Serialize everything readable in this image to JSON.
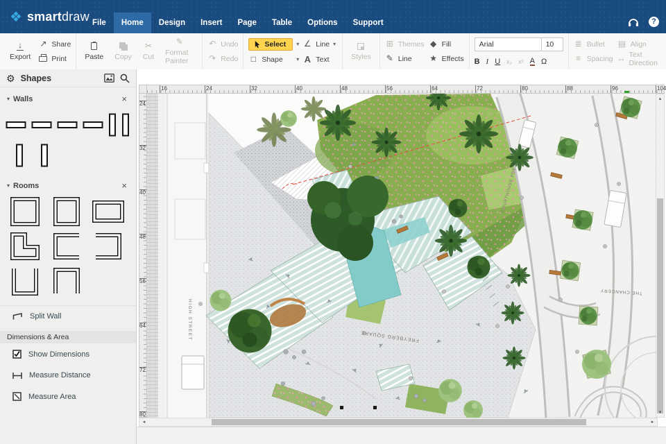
{
  "topbar": {
    "logo": {
      "bold": "smart",
      "light": "draw"
    },
    "menus": [
      {
        "label": "File"
      },
      {
        "label": "Home"
      },
      {
        "label": "Design"
      },
      {
        "label": "Insert"
      },
      {
        "label": "Page"
      },
      {
        "label": "Table"
      },
      {
        "label": "Options"
      },
      {
        "label": "Support"
      }
    ],
    "active_menu": "Home"
  },
  "toolbar": {
    "export": "Export",
    "share": "Share",
    "print": "Print",
    "paste": "Paste",
    "copy": "Copy",
    "cut": "Cut",
    "format_painter": "Format Painter",
    "undo": "Undo",
    "redo": "Redo",
    "select": "Select",
    "shape": "Shape",
    "line_tool": "Line",
    "text_tool": "Text",
    "styles": "Styles",
    "themes": "Themes",
    "line_style": "Line",
    "fill": "Fill",
    "effects": "Effects",
    "font_name": "Arial",
    "font_size": "10",
    "bold": "B",
    "italic": "I",
    "underline": "U",
    "subscript": "x₂",
    "superscript": "x²",
    "font_color": "A",
    "symbol": "Ω",
    "bullet": "Bullet",
    "spacing": "Spacing",
    "align": "Align",
    "text_direction": "Text Direction"
  },
  "icons": {
    "arrow_down": "↓",
    "share": "↗",
    "cut": "✂",
    "format_painter": "✎",
    "undo": "↶",
    "redo": "↷",
    "caret": "▾",
    "line_tool": "∠",
    "shape": "□",
    "text": "A",
    "themes": "⊞",
    "pencil": "✎",
    "fill": "◆",
    "effects": "★",
    "bullet": "≣",
    "spacing": "≡",
    "align": "▤",
    "text_direction": "↔",
    "gear": "⚙",
    "close": "×",
    "section_caret": "▾",
    "scroll_up": "▴",
    "scroll_down": "▾",
    "scroll_left": "◂",
    "scroll_right": "▸",
    "help": "?"
  },
  "sidebar": {
    "title": "Shapes",
    "sections": [
      {
        "title": "Walls"
      },
      {
        "title": "Rooms"
      }
    ],
    "split_wall": "Split Wall",
    "dimensions_header": "Dimensions & Area",
    "show_dimensions": "Show Dimensions",
    "measure_distance": "Measure Distance",
    "measure_area": "Measure Area"
  },
  "canvas": {
    "ruler_h": [
      "16",
      "24",
      "32",
      "40",
      "48",
      "56",
      "64",
      "72",
      "80",
      "88",
      "96",
      "104"
    ],
    "ruler_v": [
      "24",
      "32",
      "40",
      "48",
      "56",
      "64",
      "72",
      "80"
    ],
    "plan_labels": {
      "street": "HIGH STREET",
      "square": "FREYBERG SQUARE",
      "parade": "COURTHOUSE PDE",
      "chancery": "THE CHANCERY"
    }
  },
  "colors": {
    "topbar_blue": "#1a4b7f",
    "active_menu_blue": "#2d6aa6",
    "accent_yellow": "#fed44f",
    "lawn_green": "#88ae50",
    "steps_mint": "#cfe2dd",
    "water_teal": "#83cbc8"
  }
}
